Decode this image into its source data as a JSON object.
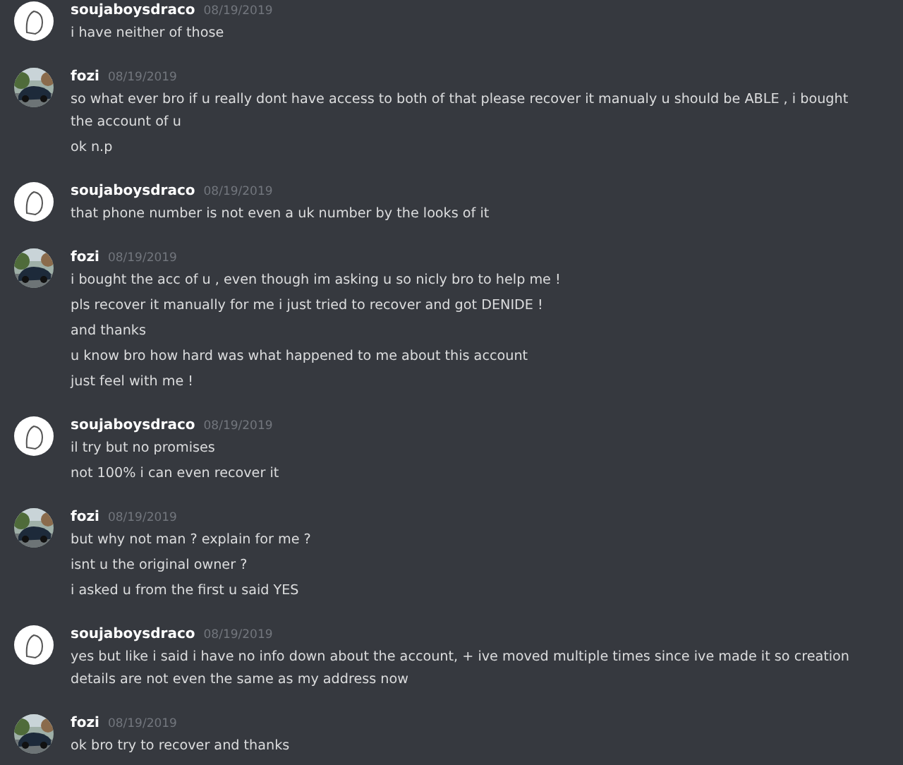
{
  "messages": [
    {
      "author": "soujaboysdraco",
      "date": "08/19/2019",
      "avatar": {
        "kind": "drawing"
      },
      "lines": [
        "i have neither of those"
      ]
    },
    {
      "author": "fozi",
      "date": "08/19/2019",
      "avatar": {
        "kind": "picture"
      },
      "lines": [
        "so what ever bro if u really dont have access to both of that please recover it manualy u should be ABLE , i bought the account of u",
        "ok n.p"
      ]
    },
    {
      "author": "soujaboysdraco",
      "date": "08/19/2019",
      "avatar": {
        "kind": "drawing"
      },
      "lines": [
        "that phone number is not even  a uk number by the looks of it"
      ]
    },
    {
      "author": "fozi",
      "date": "08/19/2019",
      "avatar": {
        "kind": "picture"
      },
      "lines": [
        "i bought the acc of u , even though im asking u so nicly bro to help me !",
        "pls recover it manually for me i just tried to recover and got DENIDE  !",
        "and thanks",
        "u know bro how hard was what happened to me about this account",
        "just feel with me !"
      ]
    },
    {
      "author": "soujaboysdraco",
      "date": "08/19/2019",
      "avatar": {
        "kind": "drawing"
      },
      "lines": [
        "il try but no promises",
        "not 100% i can even recover it"
      ]
    },
    {
      "author": "fozi",
      "date": "08/19/2019",
      "avatar": {
        "kind": "picture"
      },
      "lines": [
        "but why not man ? explain for me ?",
        "isnt u the original owner ?",
        "i asked u from the first u said YES"
      ]
    },
    {
      "author": "soujaboysdraco",
      "date": "08/19/2019",
      "avatar": {
        "kind": "drawing"
      },
      "lines": [
        "yes but like i said i have no info down about the account, + ive moved multiple times since ive made it so creation details are not even the same as my address now"
      ]
    },
    {
      "author": "fozi",
      "date": "08/19/2019",
      "avatar": {
        "kind": "picture"
      },
      "lines": [
        "ok bro try to recover and thanks"
      ]
    }
  ]
}
